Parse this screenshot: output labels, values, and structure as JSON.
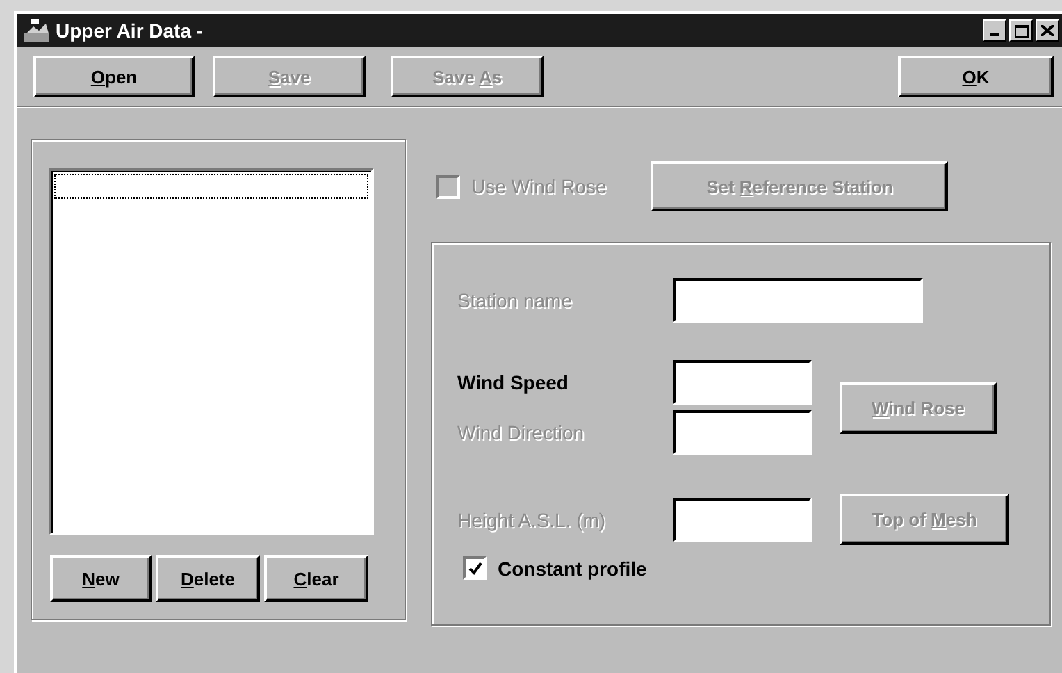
{
  "window": {
    "title": "Upper Air Data -"
  },
  "toolbar": [
    {
      "key": "O",
      "after": "pen",
      "disabled": false
    },
    {
      "key": "S",
      "after": "ave",
      "disabled": true
    },
    {
      "before": "Save ",
      "key": "A",
      "after": "s",
      "disabled": true
    }
  ],
  "ok_button": {
    "key": "O",
    "after": "K",
    "disabled": false
  },
  "list_buttons": [
    {
      "key": "N",
      "after": "ew",
      "disabled": false
    },
    {
      "key": "D",
      "after": "elete",
      "disabled": false
    },
    {
      "key": "C",
      "after": "lear",
      "disabled": false
    }
  ],
  "use_wind_rose": {
    "label": "Use Wind Rose",
    "checked": false,
    "disabled": true
  },
  "reference_button": {
    "before": "Set ",
    "key": "R",
    "after": "eference Station",
    "disabled": true
  },
  "station_name": {
    "label": "Station name",
    "disabled": true
  },
  "wind_speed": {
    "label": "Wind Speed",
    "disabled": false
  },
  "wind_direction": {
    "label": "Wind Direction",
    "disabled": true
  },
  "wind_rose_button": {
    "key": "W",
    "after": "ind Rose",
    "disabled": true
  },
  "height": {
    "label": "Height A.S.L. (m)",
    "disabled": true
  },
  "top_of_mesh_button": {
    "before": "Top of ",
    "key": "M",
    "after": "esh",
    "disabled": true
  },
  "constant_profile": {
    "label": "Constant profile",
    "checked": true,
    "disabled": false
  }
}
